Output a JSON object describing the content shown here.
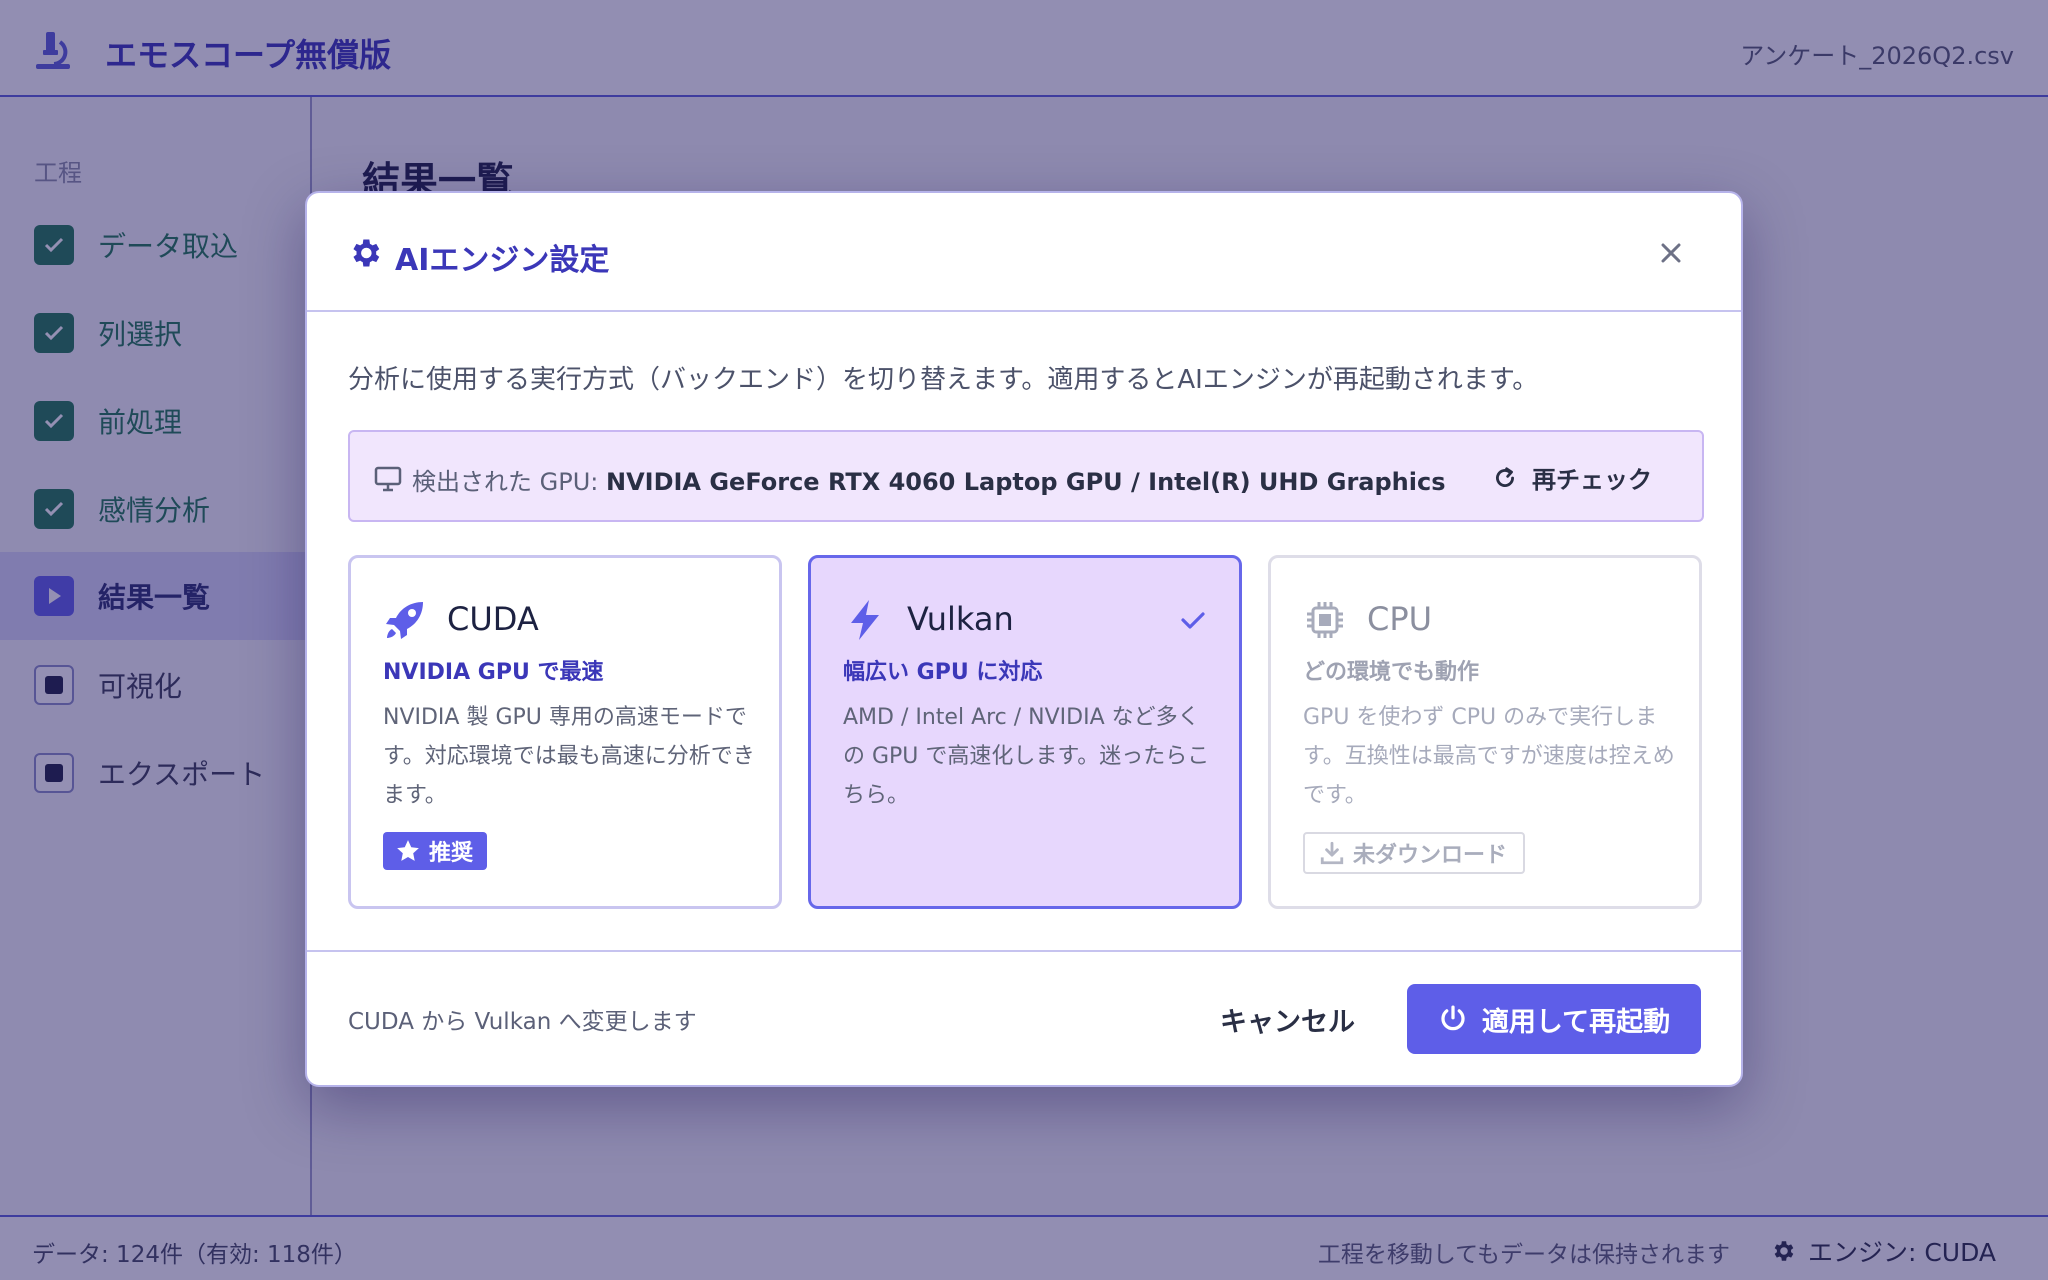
{
  "app": {
    "title": "エモスコープ無償版",
    "filename": "アンケート_2026Q2.csv"
  },
  "sidebar": {
    "heading": "工程",
    "steps": [
      {
        "label": "データ取込",
        "state": "done"
      },
      {
        "label": "列選択",
        "state": "done"
      },
      {
        "label": "前処理",
        "state": "done"
      },
      {
        "label": "感情分析",
        "state": "done"
      },
      {
        "label": "結果一覧",
        "state": "current"
      },
      {
        "label": "可視化",
        "state": "todo"
      },
      {
        "label": "エクスポート",
        "state": "todo"
      }
    ]
  },
  "main": {
    "title": "結果一覧"
  },
  "status": {
    "left": "データ: 124件（有効: 118件）",
    "mid": "工程を移動してもデータは保持されます",
    "engine": "エンジン: CUDA"
  },
  "modal": {
    "title": "AIエンジン設定",
    "description": "分析に使用する実行方式（バックエンド）を切り替えます。適用するとAIエンジンが再起動されます。",
    "gpu": {
      "label": "検出された GPU: ",
      "value": "NVIDIA GeForce RTX 4060 Laptop GPU / Intel(R) UHD Graphics",
      "recheck": "再チェック"
    },
    "cards": {
      "cuda": {
        "title": "CUDA",
        "subtitle": "NVIDIA GPU で最速",
        "body": "NVIDIA 製 GPU 専用の高速モードです。対応環境では最も高速に分析できます。",
        "badge": "推奨"
      },
      "vulkan": {
        "title": "Vulkan",
        "subtitle": "幅広い GPU に対応",
        "body": "AMD / Intel Arc / NVIDIA など多くの GPU で高速化します。迷ったらこちら。",
        "selected": true
      },
      "cpu": {
        "title": "CPU",
        "subtitle": "どの環境でも動作",
        "body": "GPU を使わず CPU のみで実行します。互換性は最高ですが速度は控えめです。",
        "badge": "未ダウンロード"
      }
    },
    "footer": {
      "note": "CUDA から Vulkan へ変更します",
      "cancel": "キャンセル",
      "apply": "適用して再起動"
    }
  },
  "colors": {
    "accent": "#5e5ee8",
    "brand": "#3b37b8",
    "done": "#1f7a52"
  }
}
